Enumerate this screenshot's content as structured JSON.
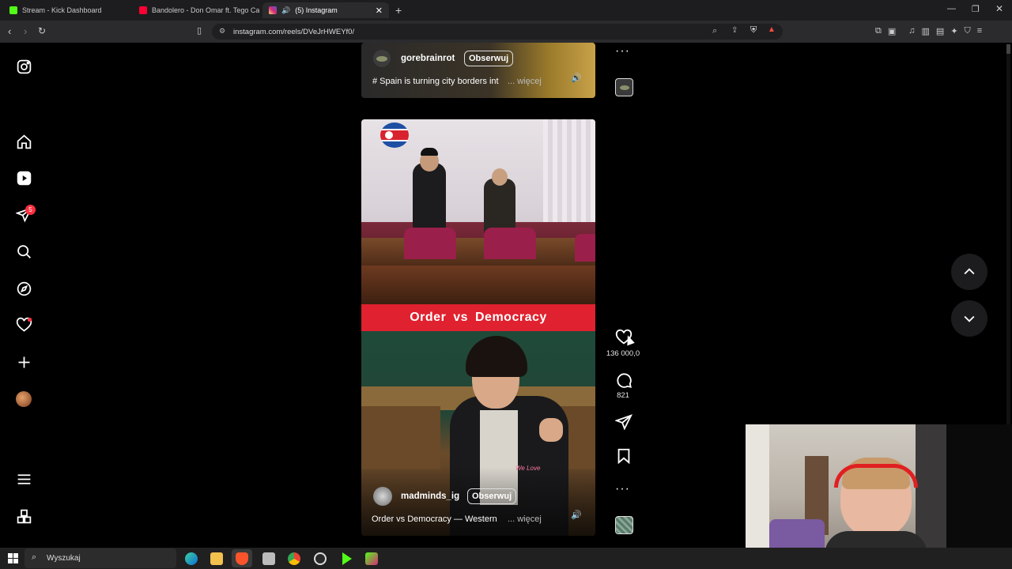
{
  "tabs": [
    {
      "label": "Stream - Kick Dashboard",
      "color": "#53fc18"
    },
    {
      "label": "Bandolero - Don Omar ft. Tego Calde",
      "color": "#ff0033"
    },
    {
      "label": "(5) Instagram",
      "color": "#d62976",
      "audio": "🔊"
    }
  ],
  "new_tab_label": "+",
  "url": "instagram.com/reels/DVeJrHWEYf0/",
  "sidebar": {
    "notifications_badge": "5"
  },
  "reel_top": {
    "username": "gorebrainrot",
    "follow": "Obserwuj",
    "caption": "# Spain is turning city borders int",
    "more": "... więcej"
  },
  "reel_main": {
    "overlay_title": "Order vs Democracy",
    "overlay_watermark": "We Love",
    "username": "madminds_ig",
    "follow": "Obserwuj",
    "caption": "Order vs Democracy — Western",
    "more": "... więcej"
  },
  "actions": {
    "likes": "136 000,0",
    "comments": "821",
    "more_top": "···",
    "more_bottom": "···"
  },
  "taskbar": {
    "search_placeholder": "Wyszukaj"
  },
  "colors": {
    "banner_red": "#e0212f",
    "badge_red": "#ff3040",
    "page_bg": "#000000"
  }
}
